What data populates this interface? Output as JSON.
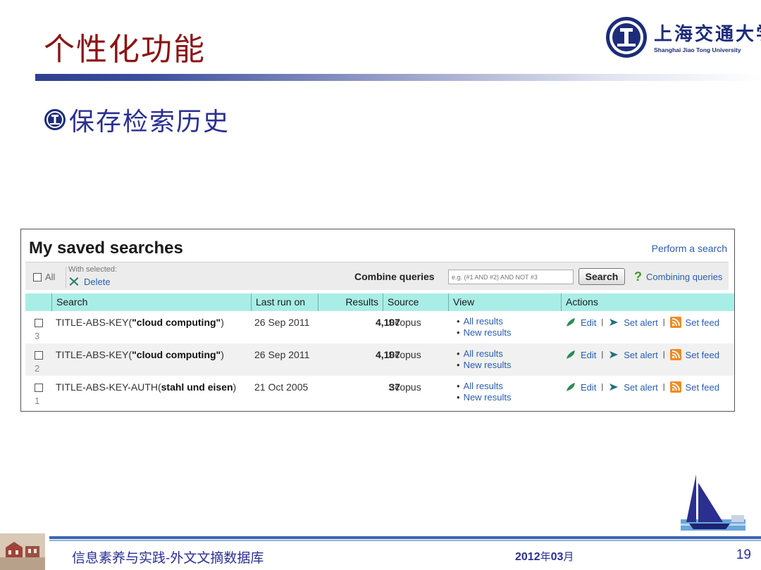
{
  "slide": {
    "title": "个性化功能",
    "subtitle": "保存检索历史",
    "logo_cn": "上海交通大学",
    "logo_en": "Shanghai Jiao Tong University"
  },
  "panel": {
    "title": "My saved searches",
    "perform_link": "Perform a search",
    "toolbar": {
      "all_label": "All",
      "with_selected": "With selected:",
      "delete_label": "Delete",
      "combine_label": "Combine queries",
      "combine_placeholder": "e.g. (#1 AND #2) AND NOT #3",
      "search_button": "Search",
      "help_link": "Combining queries"
    },
    "columns": [
      "Search",
      "Last run on",
      "Results",
      "Source",
      "View",
      "Actions"
    ],
    "rows": [
      {
        "num": "3",
        "query_prefix": "TITLE-ABS-KEY(",
        "query_bold": "\"cloud computing\"",
        "query_suffix": ")",
        "last_run": "26 Sep 2011",
        "results": "4,107",
        "source": "Scopus",
        "view_all": "All results",
        "view_new": "New results",
        "edit": "Edit",
        "alert": "Set alert",
        "feed": "Set feed"
      },
      {
        "num": "2",
        "query_prefix": "TITLE-ABS-KEY(",
        "query_bold": "\"cloud computing\"",
        "query_suffix": ")",
        "last_run": "26 Sep 2011",
        "results": "4,107",
        "source": "Scopus",
        "view_all": "All results",
        "view_new": "New results",
        "edit": "Edit",
        "alert": "Set alert",
        "feed": "Set feed"
      },
      {
        "num": "1",
        "query_prefix": "TITLE-ABS-KEY-AUTH(",
        "query_bold": "stahl und eisen",
        "query_suffix": ")",
        "last_run": "21 Oct 2005",
        "results": "37",
        "source": "Scopus",
        "view_all": "All results",
        "view_new": "New results",
        "edit": "Edit",
        "alert": "Set alert",
        "feed": "Set feed"
      }
    ]
  },
  "footer": {
    "left_text": "信息素养与实践-外文文摘数据库",
    "year": "2012",
    "year_char": "年",
    "month": "03",
    "month_char": "月",
    "page": "19"
  },
  "colors": {
    "title_red": "#8b1414",
    "text_blue": "#2a2f93",
    "link_blue": "#2a5db0",
    "header_teal": "#a9eee6"
  }
}
